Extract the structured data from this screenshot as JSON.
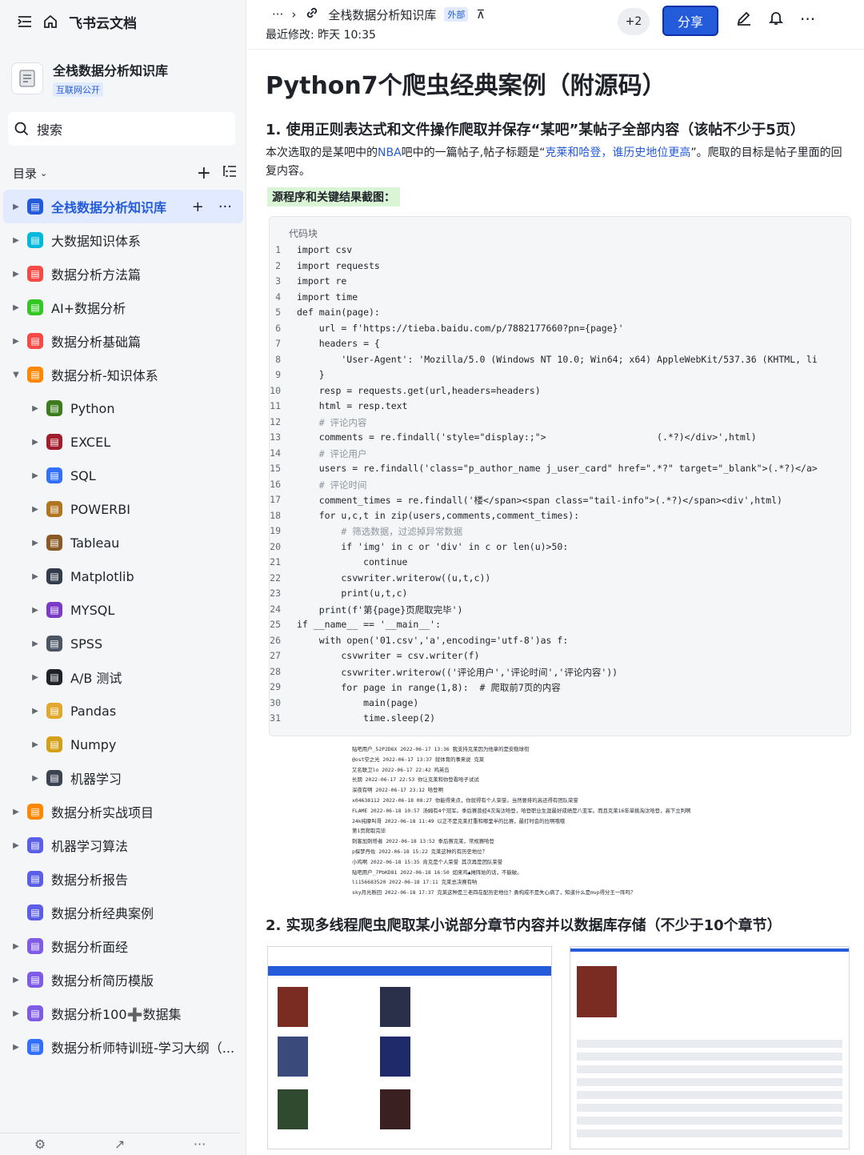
{
  "sidebar": {
    "app_title": "飞书云文档",
    "kb_title": "全栈数据分析知识库",
    "kb_badge": "互联网公开",
    "search_placeholder": "搜索",
    "toc_label": "目录",
    "items": [
      {
        "label": "全栈数据分析知识库",
        "color": "#245bdb",
        "active": true
      },
      {
        "label": "大数据知识体系",
        "color": "#00b8d9"
      },
      {
        "label": "数据分析方法篇",
        "color": "#f54a45"
      },
      {
        "label": "AI+数据分析",
        "color": "#34c724"
      },
      {
        "label": "数据分析基础篇",
        "color": "#f54a45"
      },
      {
        "label": "数据分析-知识体系",
        "color": "#ff8800",
        "expanded": true
      },
      {
        "label": "Python",
        "color": "#3d7c1e",
        "child": true
      },
      {
        "label": "EXCEL",
        "color": "#a31e2d",
        "child": true
      },
      {
        "label": "SQL",
        "color": "#3370ff",
        "child": true
      },
      {
        "label": "POWERBI",
        "color": "#b17520",
        "child": true
      },
      {
        "label": "Tableau",
        "color": "#8a5a25",
        "child": true
      },
      {
        "label": "Matplotlib",
        "color": "#333c4a",
        "child": true
      },
      {
        "label": "MYSQL",
        "color": "#7a3bc6",
        "child": true
      },
      {
        "label": "SPSS",
        "color": "#4b5563",
        "child": true
      },
      {
        "label": "A/B 测试",
        "color": "#1f2329",
        "child": true
      },
      {
        "label": "Pandas",
        "color": "#e2a72d",
        "child": true
      },
      {
        "label": "Numpy",
        "color": "#d4a017",
        "child": true
      },
      {
        "label": "机器学习",
        "color": "#3d4451",
        "child": true
      },
      {
        "label": "数据分析实战项目",
        "color": "#ff8800"
      },
      {
        "label": "机器学习算法",
        "color": "#5b5fe8"
      },
      {
        "label": "数据分析报告",
        "color": "#5b5fe8",
        "noarrow": true
      },
      {
        "label": "数据分析经典案例",
        "color": "#5b5fe8",
        "noarrow": true
      },
      {
        "label": "数据分析面经",
        "color": "#7f5ce6"
      },
      {
        "label": "数据分析简历模版",
        "color": "#7f5ce6"
      },
      {
        "label": "数据分析100➕数据集",
        "color": "#7f5ce6"
      },
      {
        "label": "数据分析师特训班-学习大纲（...",
        "color": "#3370ff"
      }
    ]
  },
  "header": {
    "breadcrumb_more": "···",
    "doc_name": "全栈数据分析知识库",
    "external_tag": "外部",
    "last_modified": "最近修改: 昨天 10:35",
    "collaborators": "+2",
    "share_label": "分享"
  },
  "doc": {
    "title": "Python7个爬虫经典案例（附源码）",
    "section1": "1. 使用正则表达式和文件操作爬取并保存“某吧”某帖子全部内容（该帖不少于5页）",
    "para_a": "本次选取的是某吧中的",
    "para_b": "NBA",
    "para_c": "吧中的一篇帖子,帖子标题是“",
    "para_d": "克莱和哈登，谁历史地位更高",
    "para_e": "”。爬取的目标是帖子里面的回复内容。",
    "mark": "源程序和关键结果截图：",
    "code_label": "代码块",
    "code_lines": [
      "import csv",
      "import requests",
      "import re",
      "import time",
      "def main(page):",
      "    url = f'https://tieba.baidu.com/p/7882177660?pn={page}'",
      "    headers = {",
      "        'User-Agent': 'Mozilla/5.0 (Windows NT 10.0; Win64; x64) AppleWebKit/537.36 (KHTML, li",
      "    }",
      "    resp = requests.get(url,headers=headers)",
      "    html = resp.text",
      "    # 评论内容",
      "    comments = re.findall('style=\"display:;\">                    (.*?)</div>',html)",
      "    # 评论用户",
      "    users = re.findall('class=\"p_author_name j_user_card\" href=\".*?\" target=\"_blank\">(.*?)</a>",
      "    # 评论时间",
      "    comment_times = re.findall('楼</span><span class=\"tail-info\">(.*?)</span><div',html)",
      "    for u,c,t in zip(users,comments,comment_times):",
      "        # 筛选数据，过滤掉异常数据",
      "        if 'img' in c or 'div' in c or len(u)>50:",
      "            continue",
      "        csvwriter.writerow((u,t,c))",
      "        print(u,t,c)",
      "    print(f'第{page}页爬取完毕')",
      "if __name__ == '__main__':",
      "    with open('01.csv','a',encoding='utf-8')as f:",
      "        csvwriter = csv.writer(f)",
      "        csvwriter.writerow(('评论用户','评论时间','评论内容'))",
      "        for page in range(1,8):  # 爬取前7页的内容",
      "            main(page)",
      "            time.sleep(2)"
    ],
    "output_lines": [
      "贴吧用户_52P2D6X 2022-06-17 13:36 我支持克莱因为他拿的是安稳球衔",
      "@ost空之光 2022-06-17 13:37 就体育的事来说 克莱",
      "又名联卫lo 2022-06-17 22:42 鸡英岛",
      "长期 2022-06-17 22:53 你让克莱和你登看哈子试试",
      "深夜有啊 2022-06-17 23:12 哈登啊",
      "x04638112 2022-06-18 08:27 你能得来点，你就得有个人荣誉。当然要排的高还得有团队荣誉",
      "FLAME 2022-06-18 10:57 汤姆有4个冠军。季后赛曾经4次淘汰哈登，哈登职业生涯最好成绩是八亚军。而且克莱16年单挑淘汰哈登，高下立判啊",
      "24k纯摩叫哥 2022-06-18 11:49 以正不是克莱打重和哪里半的比赛，最打时会的拉啊哦哦",
      "第1页爬取完毕",
      "刺客加刺塔者 2022-06-18 13:52 季后赛克莱，常规赛哈登",
      "p探梦丹佐 2022-06-18 15:22 克莱这种的有历史地位？",
      "小鸡啊 2022-06-18 15:35 肯克是个人荣誉 其次再是团队荣誉",
      "贴吧用户_7PbKD81 2022-06-18 16:50 如来鸡▲摊阵始的话，不能破。",
      "li156683520 2022-06-18 17:11 克莱总决赛有呐",
      "sky月光断回 2022-06-18 17:37 克莱这种是三老四在配历史地位？勇构成不是失心病了，知道什么是mvp得分王一阵吗？"
    ],
    "section2": "2. 实现多线程爬虫爬取某小说部分章节内容并以数据库存储（不少于10个章节）"
  }
}
